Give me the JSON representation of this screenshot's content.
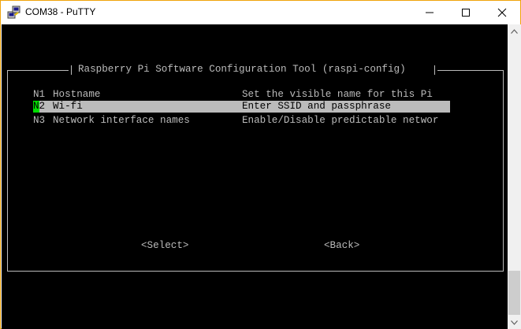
{
  "window": {
    "title": "COM38 - PuTTY",
    "icons": {
      "app": "putty-icon",
      "minimize": "minimize-icon",
      "maximize": "maximize-icon",
      "close": "close-icon"
    },
    "accent_color": "#f0a30a"
  },
  "dialog": {
    "title": "Raspberry Pi Software Configuration Tool (raspi-config)",
    "items": [
      {
        "code": "N1",
        "name": "Hostname",
        "description": "Set the visible name for this Pi"
      },
      {
        "code": "N2",
        "name": "Wi-fi",
        "description": "Enter SSID and passphrase"
      },
      {
        "code": "N3",
        "name": "Network interface names",
        "description": "Enable/Disable predictable networ"
      }
    ],
    "selected_index": 1,
    "buttons": {
      "select": "<Select>",
      "back": "<Back>"
    }
  },
  "colors": {
    "terminal_bg": "#000000",
    "terminal_fg": "#bbbbbb",
    "highlight_bg": "#bbbbbb",
    "cursor": "#00dd00"
  }
}
